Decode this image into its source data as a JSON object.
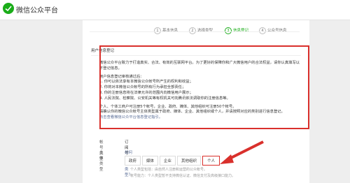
{
  "app": {
    "title": "微信公众平台"
  },
  "steps": [
    {
      "num": "1",
      "label": "基本信息",
      "active": false
    },
    {
      "num": "2",
      "label": "选择类型",
      "active": false
    },
    {
      "num": "3",
      "label": "信息登记",
      "active": true
    },
    {
      "num": "4",
      "label": "公众号信息",
      "active": false
    }
  ],
  "section_title": "用户信息登记",
  "notice": {
    "intro": "微信公众平台致力于打造真实、合法、有效的互联网平台。为了更好的保障你和广大微信用户的合法权益，请你认真填写以下登记信息。",
    "rights_title": "用户信息登记审核通过后：",
    "rights": [
      "1. 你可以依法享有本微信公众帐号所产生的权利和收益；",
      "2. 你将对本微信公众帐号的所有行为承担全部责任；",
      "3. 你的注册信息将在法律允许的范围内向微信用户展示；",
      "4. 人民法院、检察院、公安机关等有权机关可向腾讯依法调取你的注册信息等。"
    ],
    "limit": "个人、个体工商户可注册5个帐号，企业、政府、媒体、其他组织可注册50个帐号。",
    "guide": "请确认你的微信公众帐号主体类型属于政府、媒体、企业、其他组织或个人，并请按照对应的类别进行信息登记。",
    "guide_link": "点击查看微信公众平台信息登记指引。"
  },
  "form": {
    "account_type_label": "帐号类型",
    "account_type_value": "订阅号",
    "subject_type_label": "主体类型",
    "subject_question": "如何选择主体类型？",
    "options": [
      "政府",
      "媒体",
      "企业",
      "其他组织",
      "个人"
    ],
    "selected_option": "个人",
    "hints": [
      "个人类型包括：由自然人注册和运营的公众帐号。",
      "帐号能力：个人类型暂不支持微信认证、微信支付及高级接口能力。"
    ]
  },
  "colors": {
    "accent": "#1aad19",
    "highlight": "#d9302c",
    "link": "#576b95"
  }
}
